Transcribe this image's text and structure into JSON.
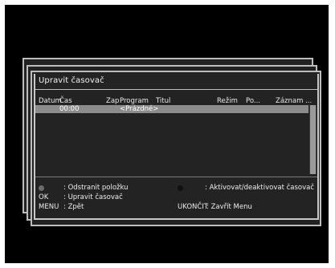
{
  "dialog": {
    "title": "Upravit časovač"
  },
  "table": {
    "headers": [
      "Datum",
      "Čas",
      "Zap",
      "Program",
      "Titul",
      "Režim",
      "Po...",
      "Záznam ..."
    ],
    "rows": [
      {
        "datum": "",
        "cas": "00:00",
        "zap": "",
        "program": "<Prázdné>",
        "titul": "",
        "rezim": "",
        "po": "",
        "zaznam": ""
      }
    ]
  },
  "legend": {
    "remove_key_color": "#6b6b6b",
    "remove_label": ": Odstranit položku",
    "toggle_key_color": "#111111",
    "toggle_label": ": Aktivovat/deaktivovat časovač",
    "ok_key": "OK",
    "ok_label": ": Upravit časovač",
    "menu_key": "MENU",
    "menu_label": ": Zpět",
    "exit_key": "UKONČIT",
    "exit_label": ": Zavřít Menu"
  }
}
